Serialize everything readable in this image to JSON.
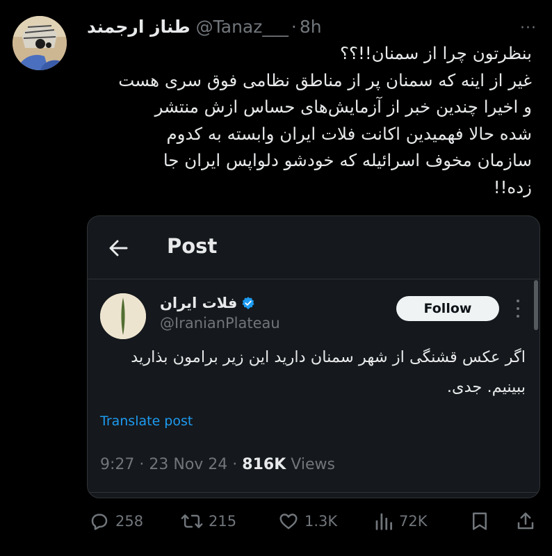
{
  "tweet": {
    "author_name": "طناز ارجمند",
    "handle": "@Tanaz___",
    "separator": "·",
    "time": "8h",
    "more_label": "···",
    "text": "بنظرتون چرا از سمنان!!؟؟\nغیر از اینه که سمنان پر از مناطق نظامی فوق سری هست\nو اخیرا چندین خبر از آزمایش‌های حساس ازش منتشر\nشده حالا فهمیدین اکانت فلات ایران وابسته به کدوم\nسازمان مخوف اسرائیله که خودشو دلواپس ایران جا\nزده!!"
  },
  "quoted_card": {
    "header_title": "Post",
    "author_name": "فلات ایران",
    "handle": "@IranianPlateau",
    "follow_label": "Follow",
    "text": "اگر عکس قشنگی از شهر سمنان دارید این زیر برامون\nبذارید ببینیم. جدی.",
    "translate_label": "Translate post",
    "time": "9:27",
    "sep1": " · ",
    "date": "23 Nov 24",
    "sep2": " · ",
    "views_count": "816K",
    "views_label": " Views",
    "verified_color": "#1d9bf0"
  },
  "actions": {
    "replies": "258",
    "reposts": "215",
    "likes": "1.3K",
    "views": "72K"
  },
  "colors": {
    "background": "#000000",
    "text": "#e7e9ea",
    "muted": "#71767b",
    "accent": "#1d9bf0",
    "card": "#15181c"
  }
}
